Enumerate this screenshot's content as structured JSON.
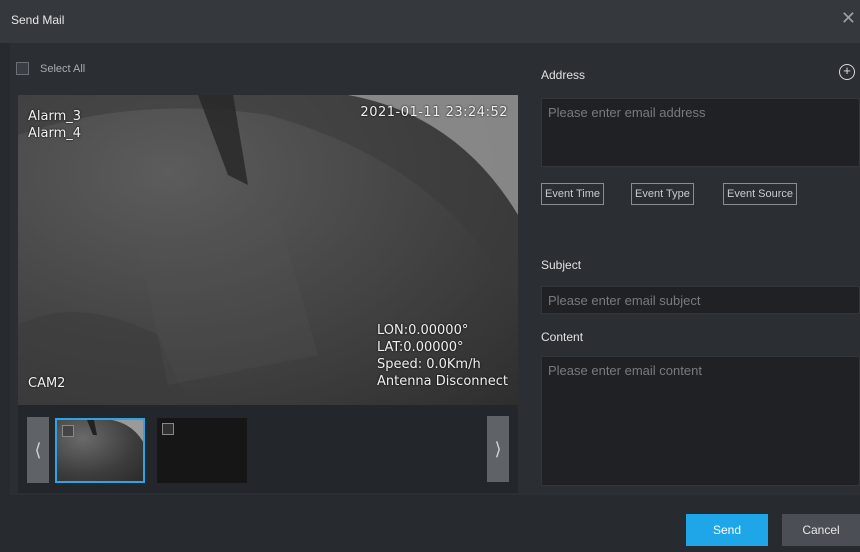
{
  "window": {
    "title": "Send Mail",
    "close_glyph": "✕"
  },
  "left_pane": {
    "select_all_label": "Select All",
    "video": {
      "alarm_lines": [
        "Alarm_3",
        "Alarm_4"
      ],
      "timestamp": "2021-01-11 23:24:52",
      "camera_label": "CAM2",
      "gps_lines": [
        "LON:0.00000°",
        "LAT:0.00000°",
        "Speed: 0.0Km/h",
        "Antenna Disconnect"
      ]
    },
    "prev_glyph": "⟨",
    "next_glyph": "⟩"
  },
  "right_pane": {
    "address_label": "Address",
    "add_glyph": "+",
    "address_placeholder": "Please enter email address",
    "tags": [
      "Event Time",
      "Event Type",
      "Event Source"
    ],
    "subject_label": "Subject",
    "subject_placeholder": "Please enter email subject",
    "content_label": "Content",
    "content_placeholder": "Please enter email content"
  },
  "footer": {
    "send_label": "Send",
    "cancel_label": "Cancel"
  },
  "colors": {
    "accent": "#1ea6e8",
    "thumb_selected": "#2fa3e6",
    "background": "#272a2f"
  }
}
